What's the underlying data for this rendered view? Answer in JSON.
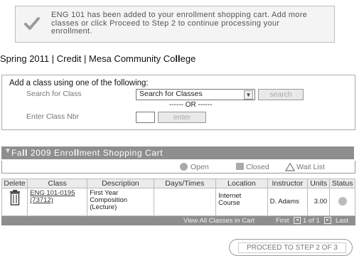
{
  "notice": {
    "icon": "checkmark-icon",
    "line1": "ENG 101 has been added to your enrollment shopping cart. Add more",
    "line2": "classes or click Proceed to Step 2 to continue processing your",
    "line3": "enrollment."
  },
  "term": {
    "prefix": "Spring 2011 | Credit | Mesa Community Co",
    "bold": "ll",
    "suffix": "ege"
  },
  "add_class": {
    "title": "Add a class using one of the following:",
    "search_label": "Search for Class",
    "select_value": "Search for Classes",
    "search_button": "search",
    "or_text": "------ OR ------",
    "nbr_label": "Enter Class Nbr",
    "nbr_value": "",
    "enter_button": "enter"
  },
  "cart": {
    "title_pre": "Fa",
    "title_bold": "ll",
    "title_mid": " 2009 Enro",
    "title_bold2": "ll",
    "title_post": "ment Shopping Cart",
    "legend": {
      "open": "Open",
      "closed": "Closed",
      "waitlist": "Wait List"
    },
    "columns": [
      "Delete",
      "Class",
      "Description",
      "Days/Times",
      "Location",
      "Instructor",
      "Units",
      "Status"
    ],
    "rows": [
      {
        "class_line1": "ENG 101-0195",
        "class_line2": "(73712)",
        "desc1": "First Year",
        "desc2": "Composition",
        "desc3": "(Lecture)",
        "days": "",
        "loc1": "Internet",
        "loc2": "Course",
        "instructor": "D. Adams",
        "units": "3.00"
      }
    ],
    "footer": {
      "view_all": "View All Classes in Cart",
      "pager_first": "First",
      "pager_info": "1 of 1",
      "pager_last": "Last"
    }
  },
  "proceed_button": "PROCEED TO STEP 2 OF 3"
}
